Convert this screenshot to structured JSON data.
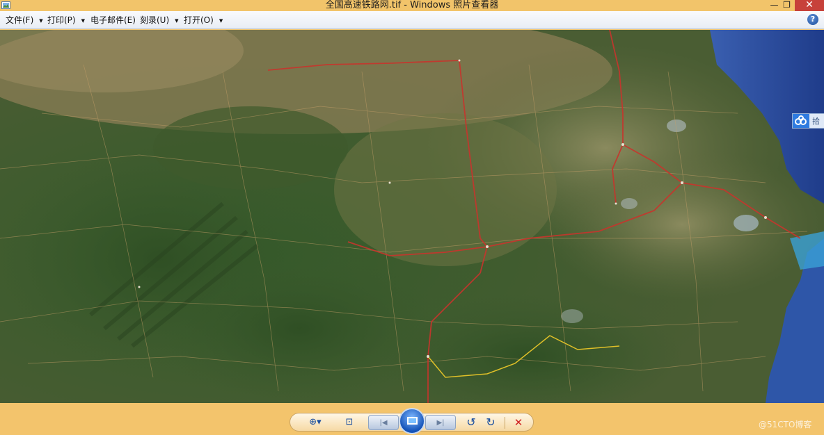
{
  "window": {
    "title": "全国高速铁路网.tif - Windows 照片查看器",
    "min_glyph": "—",
    "max_glyph": "❐",
    "close_glyph": "✕"
  },
  "menu": [
    {
      "label": "文件(F)",
      "arrow": "▼"
    },
    {
      "label": "打印(P)",
      "arrow": "▼"
    },
    {
      "label": "电子邮件(E)",
      "arrow": ""
    },
    {
      "label": "刻录(U)",
      "arrow": "▼"
    },
    {
      "label": "打开(O)",
      "arrow": "▼"
    }
  ],
  "help": {
    "glyph": "?"
  },
  "side_tab": {
    "label": "拾"
  },
  "toolbar": {
    "zoom_glyph": "⊕▾",
    "fit_glyph": "⊡",
    "prev_glyph": "|◀",
    "next_glyph": "▶|",
    "rotate_ccw_glyph": "↺",
    "rotate_cw_glyph": "↻",
    "delete_glyph": "✕"
  },
  "watermark": "@51CTO博客",
  "colors": {
    "chrome": "#f2c46a",
    "railway": "#c8342c",
    "sea": "#2e4f9e"
  }
}
